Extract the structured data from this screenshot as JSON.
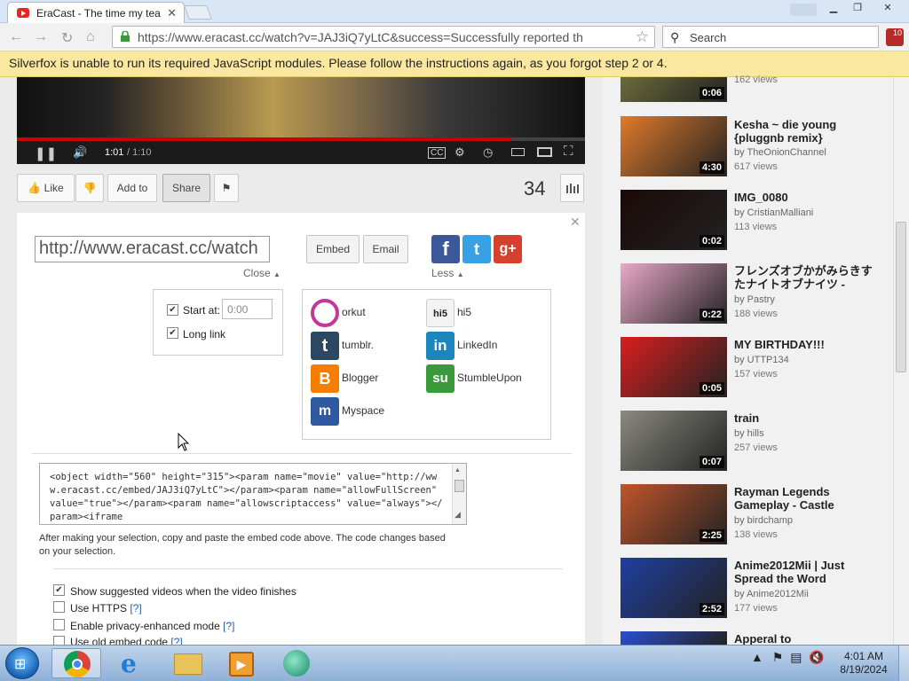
{
  "browser": {
    "tab_title": "EraCast - The time my tea",
    "url": "https://www.eracast.cc/watch?v=JAJ3iQ7yLtC&success=Successfully reported th",
    "search_placeholder": "Search",
    "extension_badge": "10"
  },
  "infobar": {
    "message": "Silverfox is unable to run its required JavaScript modules. Please follow the instructions again, as you forgot step 2 or 4."
  },
  "player": {
    "time_current": "1:01",
    "time_total": "/ 1:10",
    "progress_fraction": 0.87
  },
  "actions": {
    "like_label": "Like",
    "add_to_label": "Add to",
    "share_label": "Share",
    "view_count": "34"
  },
  "share": {
    "url_value": "http://www.eracast.cc/watch",
    "close_label": "Close",
    "embed_label": "Embed",
    "email_label": "Email",
    "less_label": "Less",
    "start_at_label": "Start at:",
    "start_at_value": "0:00",
    "long_link_label": "Long link",
    "services": [
      {
        "name": "orkut",
        "icon": "orkut-icon",
        "color": "#c3379b"
      },
      {
        "name": "hi5",
        "icon": "hi5-icon",
        "color": "#f5f5f5"
      },
      {
        "name": "tumblr.",
        "icon": "tumblr-icon",
        "color": "#2c4762"
      },
      {
        "name": "LinkedIn",
        "icon": "linkedin-icon",
        "color": "#1b86bc"
      },
      {
        "name": "Blogger",
        "icon": "blogger-icon",
        "color": "#f57d00"
      },
      {
        "name": "StumbleUpon",
        "icon": "stumbleupon-icon",
        "color": "#3a9a3a"
      },
      {
        "name": "Myspace",
        "icon": "myspace-icon",
        "color": "#2f5aa0"
      }
    ],
    "embed_code": "<object width=\"560\" height=\"315\"><param name=\"movie\" value=\"http://www.eracast.cc/embed/JAJ3iQ7yLtC\"></param><param name=\"allowFullScreen\" value=\"true\"></param><param name=\"allowscriptaccess\" value=\"always\"></param><iframe",
    "embed_help": "After making your selection, copy and paste the embed code above. The code changes based on your selection.",
    "options": [
      {
        "label": "Show suggested videos when the video finishes",
        "checked": true,
        "help": ""
      },
      {
        "label": "Use HTTPS",
        "checked": false,
        "help": "[?]"
      },
      {
        "label": "Enable privacy-enhanced mode",
        "checked": false,
        "help": "[?]"
      },
      {
        "label": "Use old embed code",
        "checked": false,
        "help": "[?]"
      }
    ]
  },
  "sidebar": {
    "videos": [
      {
        "title": "",
        "by": "",
        "views": "162 views",
        "duration": "0:06",
        "thumb_color": "#6b6a3a"
      },
      {
        "title": "Kesha ~ die young {pluggnb remix}",
        "by": "by TheOnionChannel",
        "views": "617 views",
        "duration": "4:30",
        "thumb_color": "#e07a2a"
      },
      {
        "title": "IMG_0080",
        "by": "by CristianMalliani",
        "views": "113 views",
        "duration": "0:02",
        "thumb_color": "#1a0a08"
      },
      {
        "title": "フレンズオブかがみらきすたナイトオブナイツ -",
        "by": "by Pastry",
        "views": "188 views",
        "duration": "0:22",
        "thumb_color": "#e9a8c8"
      },
      {
        "title": "MY BIRTHDAY!!!",
        "by": "by UTTP134",
        "views": "157 views",
        "duration": "0:05",
        "thumb_color": "#d91e1e"
      },
      {
        "title": "train",
        "by": "by hills",
        "views": "257 views",
        "duration": "0:07",
        "thumb_color": "#8a8a80"
      },
      {
        "title": "Rayman Legends Gameplay - Castle",
        "by": "by birdchamp",
        "views": "138 views",
        "duration": "2:25",
        "thumb_color": "#c0552a"
      },
      {
        "title": "Anime2012Mii | Just Spread the Word",
        "by": "by Anime2012Mii",
        "views": "177 views",
        "duration": "2:52",
        "thumb_color": "#1f3fa0"
      },
      {
        "title": "Apperal to",
        "by": "",
        "views": "",
        "duration": "",
        "thumb_color": "#2a4fd0"
      }
    ]
  },
  "taskbar": {
    "time": "4:01 AM",
    "date": "8/19/2024"
  }
}
